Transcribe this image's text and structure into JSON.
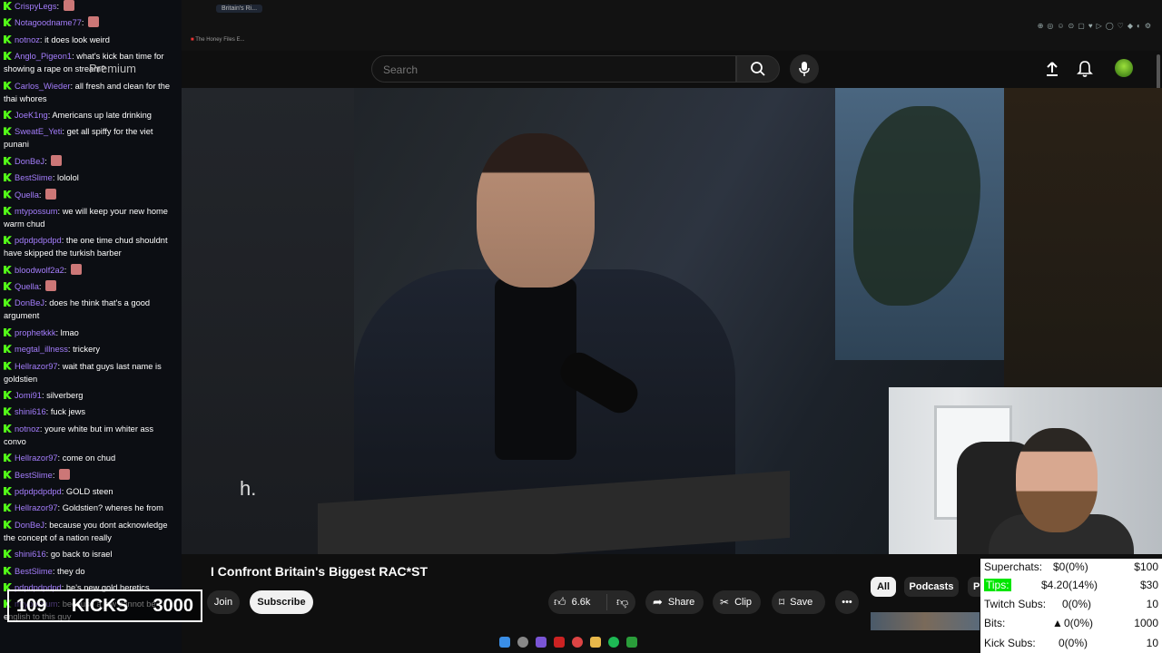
{
  "browser": {
    "tabs": [
      "Britain's Ri...",
      "The Honey Files E..."
    ],
    "bookmark": "The Honey Files E...",
    "window_controls": [
      "minimize",
      "maximize",
      "close"
    ]
  },
  "youtube": {
    "search_placeholder": "Search",
    "premium_label": "Premium",
    "video": {
      "caption": "h.",
      "title": "I Confront Britain's Biggest RAC*ST",
      "join_label": "Join",
      "subscribe_label": "Subscribe",
      "likes": "6.6k",
      "share_label": "Share",
      "clip_label": "Clip",
      "save_label": "Save"
    },
    "chips": [
      "All",
      "Podcasts",
      "P"
    ]
  },
  "chat": {
    "messages": [
      {
        "user": "CrispyLegs",
        "text": ""
      },
      {
        "user": "Notagoodname77",
        "text": ""
      },
      {
        "user": "notnoz",
        "text": "it does look weird"
      },
      {
        "user": "Anglo_Pigeon1",
        "text": "what's kick ban time for showing a rape on stream?"
      },
      {
        "user": "Carlos_Wieder",
        "text": "all fresh and clean for the thai whores"
      },
      {
        "user": "JoeK1ng",
        "text": "Americans up late drinking"
      },
      {
        "user": "SweatE_Yeti",
        "text": "get all spiffy for the viet punani"
      },
      {
        "user": "DonBeJ",
        "text": ""
      },
      {
        "user": "BestSlime",
        "text": "lololol"
      },
      {
        "user": "Quella",
        "text": ""
      },
      {
        "user": "mtypossum",
        "text": "we will keep your new home warm chud"
      },
      {
        "user": "pdpdpdpdpd",
        "text": "the one time chud shouldnt have skipped the turkish barber"
      },
      {
        "user": "bloodwolf2a2",
        "text": ""
      },
      {
        "user": "Quella",
        "text": ""
      },
      {
        "user": "DonBeJ",
        "text": "does he think that's a good argument"
      },
      {
        "user": "prophetkkk",
        "text": "lmao"
      },
      {
        "user": "megtal_illness",
        "text": "trickery"
      },
      {
        "user": "Hellrazor97",
        "text": "wait that guys last name is goldstien"
      },
      {
        "user": "Jomi91",
        "text": "silverberg"
      },
      {
        "user": "shini616",
        "text": "fuck jews"
      },
      {
        "user": "notnoz",
        "text": "youre white but im whiter ass convo"
      },
      {
        "user": "Hellrazor97",
        "text": "come on chud"
      },
      {
        "user": "BestSlime",
        "text": ""
      },
      {
        "user": "pdpdpdpdpd",
        "text": "GOLD steen"
      },
      {
        "user": "Hellrazor97",
        "text": "Goldstien? wheres he from"
      },
      {
        "user": "DonBeJ",
        "text": "because you dont acknowledge the concept of a nation really"
      },
      {
        "user": "shini616",
        "text": "go back to israel"
      },
      {
        "user": "BestSlime",
        "text": "they do"
      },
      {
        "user": "pdpdpdpdpd",
        "text": "he's new gold heretics"
      },
      {
        "user": "mtypossum",
        "text": "because a jew cannot be english to this guy"
      }
    ]
  },
  "kicks_goal": {
    "current": "109",
    "label": "KICKS",
    "target": "3000"
  },
  "stats": {
    "rows": [
      {
        "label": "Superchats:",
        "value": "$0(0%)",
        "goal": "$100"
      },
      {
        "label": "Tips:",
        "value": "$4.20(14%)",
        "goal": "$30"
      },
      {
        "label": "Twitch Subs:",
        "value": "0(0%)",
        "goal": "10"
      },
      {
        "label": "Bits:",
        "value": "0(0%)",
        "goal": "1000"
      },
      {
        "label": "Kick Subs:",
        "value": "0(0%)",
        "goal": "10"
      }
    ],
    "highlight_color": "#00e600"
  },
  "colors": {
    "accent": "#53fc18",
    "username": "#a47dfc",
    "youtube_bg": "#0f0f0f"
  }
}
